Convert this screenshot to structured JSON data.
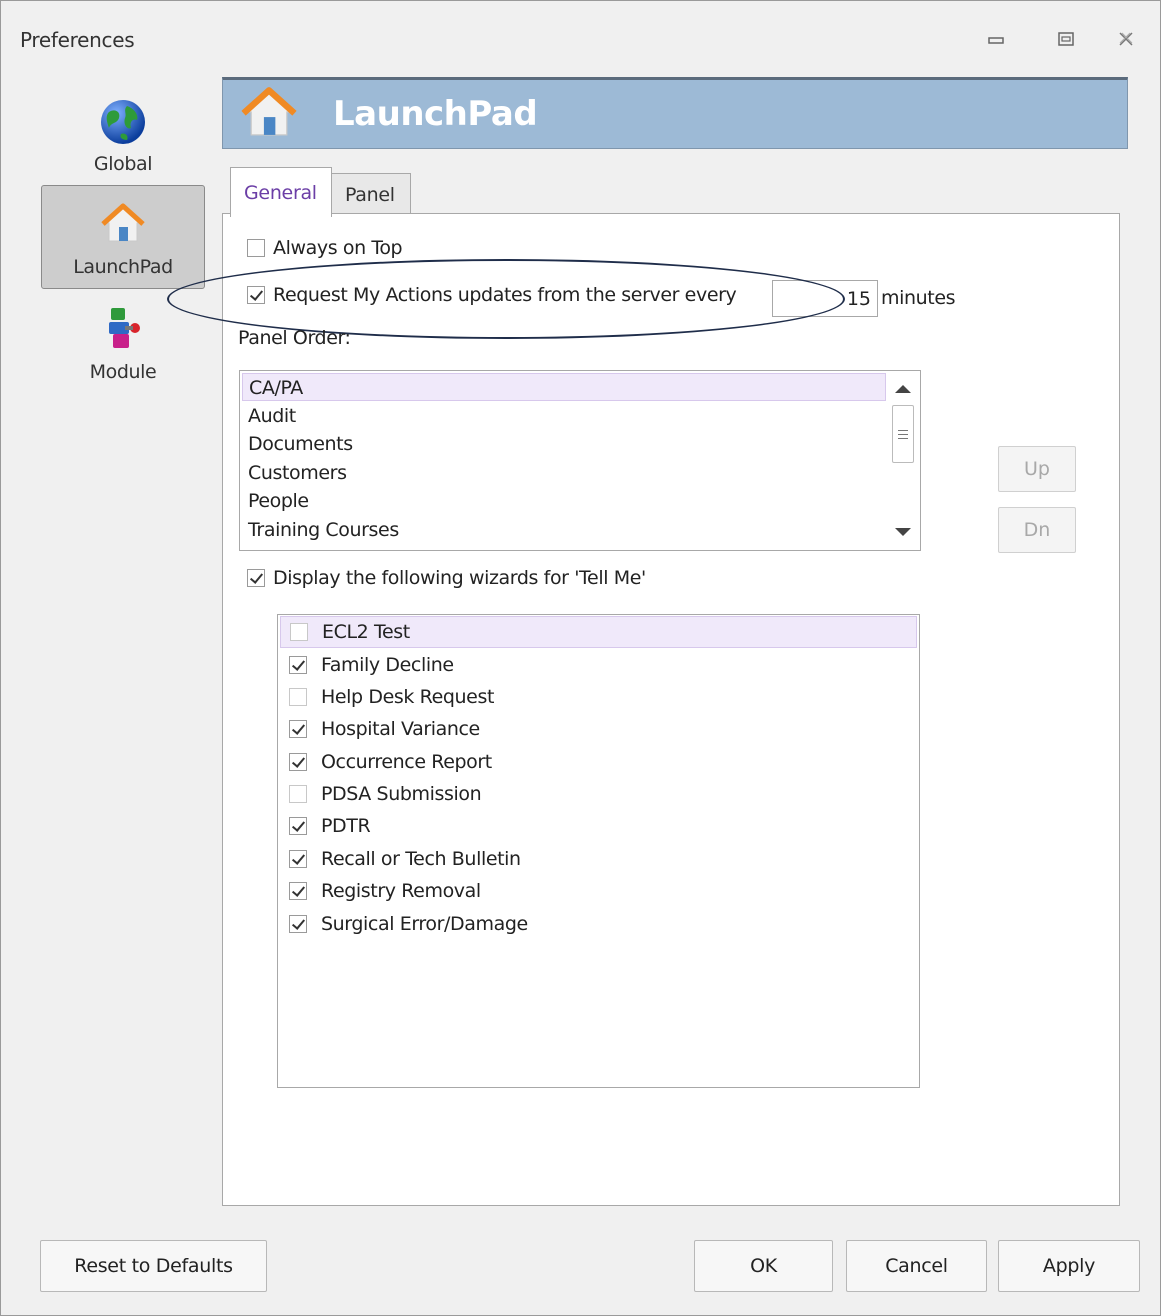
{
  "window": {
    "title": "Preferences"
  },
  "nav": [
    {
      "label": "Global",
      "icon": "globe-icon"
    },
    {
      "label": "LaunchPad",
      "icon": "house-icon",
      "active": true
    },
    {
      "label": "Module",
      "icon": "module-icon"
    }
  ],
  "banner": {
    "title": "LaunchPad"
  },
  "tabs": [
    {
      "label": "General"
    },
    {
      "label": "Panel"
    }
  ],
  "general": {
    "always_on_top": {
      "label": "Always on Top",
      "checked": false
    },
    "request_updates": {
      "label": "Request My Actions updates from the server every",
      "checked": true,
      "value": "15",
      "unit": "minutes"
    },
    "panel_order_label": "Panel Order:",
    "panel_order": [
      "CA/PA",
      "Audit",
      "Documents",
      "Customers",
      "People",
      "Training Courses"
    ],
    "up_label": "Up",
    "dn_label": "Dn",
    "display_wizards": {
      "label": "Display the following wizards for 'Tell Me'",
      "checked": true
    },
    "wizards": [
      {
        "label": "ECL2 Test",
        "checked": false
      },
      {
        "label": "Family Decline",
        "checked": true
      },
      {
        "label": "Help Desk Request",
        "checked": false
      },
      {
        "label": "Hospital Variance",
        "checked": true
      },
      {
        "label": "Occurrence Report",
        "checked": true
      },
      {
        "label": "PDSA Submission",
        "checked": false
      },
      {
        "label": "PDTR",
        "checked": true
      },
      {
        "label": "Recall or Tech Bulletin",
        "checked": true
      },
      {
        "label": "Registry Removal",
        "checked": true
      },
      {
        "label": "Surgical Error/Damage",
        "checked": true
      }
    ]
  },
  "buttons": {
    "reset": "Reset to Defaults",
    "ok": "OK",
    "cancel": "Cancel",
    "apply": "Apply"
  },
  "colors": {
    "banner": "#9dbad6",
    "selected_row": "#f0e9fa",
    "active_tab_text": "#6b3ea6"
  }
}
